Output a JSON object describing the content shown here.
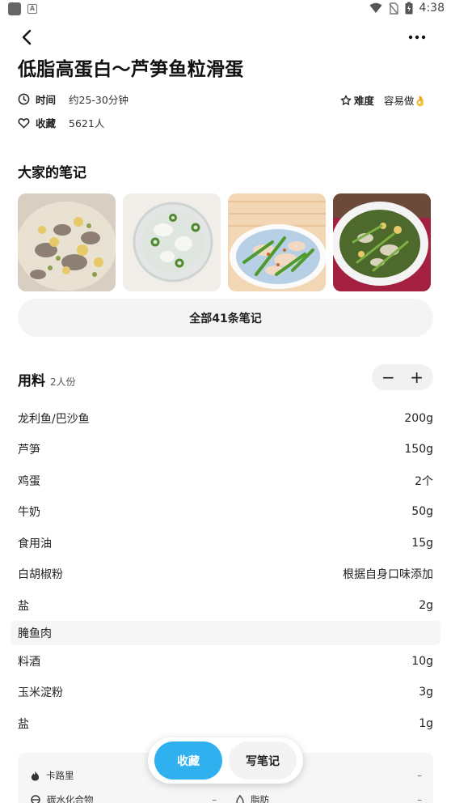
{
  "status_bar": {
    "time": "4:38"
  },
  "recipe": {
    "title": "低脂高蛋白～芦笋鱼粒滑蛋",
    "time_label": "时间",
    "time_value": "约25-30分钟",
    "difficulty_label": "难度",
    "difficulty_value": "容易做👌",
    "favorites_label": "收藏",
    "favorites_value": "5621人"
  },
  "notes": {
    "title": "大家的笔记",
    "all_notes_label": "全部41条笔记"
  },
  "ingredients": {
    "title": "用料",
    "servings": "2人份",
    "minus": "−",
    "plus": "+",
    "items_a": [
      {
        "name": "龙利鱼/巴沙鱼",
        "amount": "200g"
      },
      {
        "name": "芦笋",
        "amount": "150g"
      },
      {
        "name": "鸡蛋",
        "amount": "2个"
      },
      {
        "name": "牛奶",
        "amount": "50g"
      },
      {
        "name": "食用油",
        "amount": "15g"
      },
      {
        "name": "白胡椒粉",
        "amount": "根据自身口味添加"
      },
      {
        "name": "盐",
        "amount": "2g"
      }
    ],
    "group": "腌鱼肉",
    "items_b": [
      {
        "name": "料酒",
        "amount": "10g"
      },
      {
        "name": "玉米淀粉",
        "amount": "3g"
      },
      {
        "name": "盐",
        "amount": "1g"
      }
    ]
  },
  "nutrition": {
    "calories_label": "卡路里",
    "calories_value": "–",
    "carbs_label": "碳水化合物",
    "carbs_value": "–",
    "fat_label": "脂肪",
    "fat_value": "–"
  },
  "actions": {
    "favorite_label": "收藏",
    "write_note_label": "写笔记"
  }
}
